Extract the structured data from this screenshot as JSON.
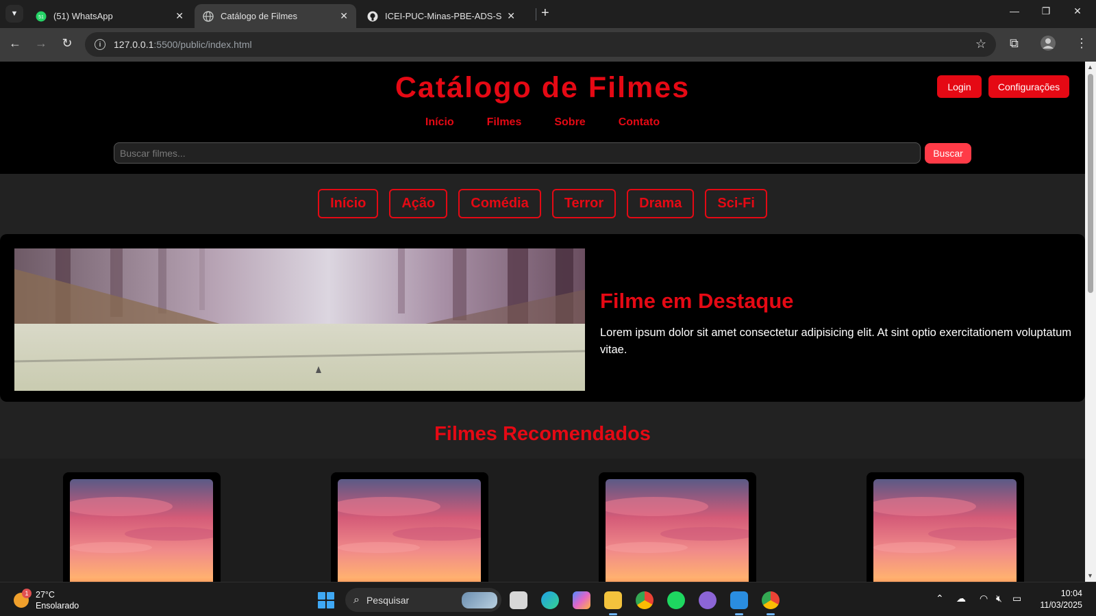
{
  "browser": {
    "tabs": [
      {
        "label": "(51) WhatsApp",
        "icon": "whatsapp-icon",
        "active": false
      },
      {
        "label": "Catálogo de Filmes",
        "icon": "globe-icon",
        "active": true
      },
      {
        "label": "ICEI-PUC-Minas-PBE-ADS-SI/tr",
        "icon": "github-icon",
        "active": false
      }
    ],
    "url_host": "127.0.0.1",
    "url_path": ":5500/public/index.html"
  },
  "site": {
    "title": "Catálogo de Filmes",
    "login_label": "Login",
    "settings_label": "Configurações",
    "nav": [
      "Início",
      "Filmes",
      "Sobre",
      "Contato"
    ],
    "search_placeholder": "Buscar filmes...",
    "search_button": "Buscar",
    "categories": [
      "Início",
      "Ação",
      "Comédia",
      "Terror",
      "Drama",
      "Sci-Fi"
    ],
    "featured": {
      "title": "Filme em Destaque",
      "description": "Lorem ipsum dolor sit amet consectetur adipisicing elit. At sint optio exercitationem voluptatum vitae."
    },
    "recommended_title": "Filmes Recomendados",
    "accent_color": "#e50914"
  },
  "taskbar": {
    "weather_temp": "27°C",
    "weather_desc": "Ensolarado",
    "weather_badge": "1",
    "search_label": "Pesquisar",
    "time": "10:04",
    "date": "11/03/2025"
  }
}
